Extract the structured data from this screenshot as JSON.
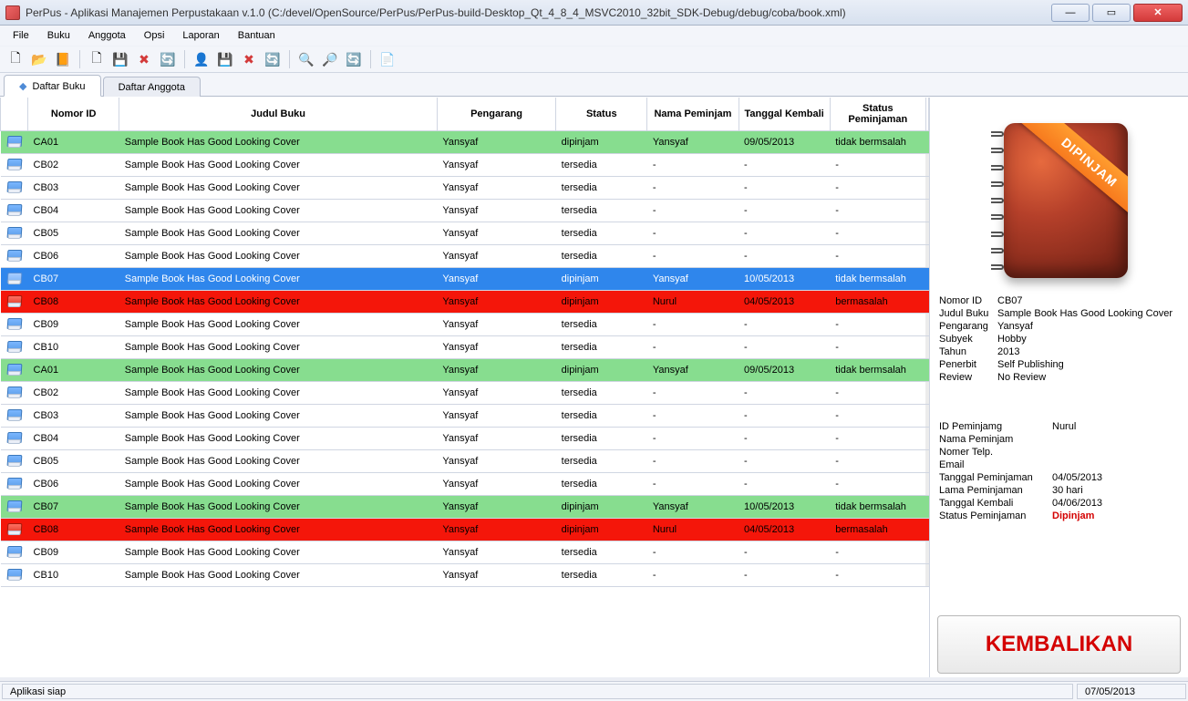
{
  "window": {
    "title": "PerPus - Aplikasi Manajemen Perpustakaan v.1.0 (C:/devel/OpenSource/PerPus/PerPus-build-Desktop_Qt_4_8_4_MSVC2010_32bit_SDK-Debug/debug/coba/book.xml)"
  },
  "menubar": [
    "File",
    "Buku",
    "Anggota",
    "Opsi",
    "Laporan",
    "Bantuan"
  ],
  "tabs": [
    {
      "label": "Daftar Buku",
      "active": true
    },
    {
      "label": "Daftar Anggota",
      "active": false
    }
  ],
  "table": {
    "headers": [
      "",
      "Nomor ID",
      "Judul Buku",
      "Pengarang",
      "Status",
      "Nama Peminjam",
      "Tanggal Kembali",
      "Status Peminjaman"
    ],
    "rows": [
      {
        "row_type": "green",
        "id": "CA01",
        "title": "Sample Book Has Good Looking Cover",
        "author": "Yansyaf",
        "status": "dipinjam",
        "borrower": "Yansyaf",
        "return": "09/05/2013",
        "loan_status": "tidak bermsalah"
      },
      {
        "row_type": "",
        "id": "CB02",
        "title": "Sample Book Has Good Looking Cover",
        "author": "Yansyaf",
        "status": "tersedia",
        "borrower": "-",
        "return": "-",
        "loan_status": "-"
      },
      {
        "row_type": "",
        "id": "CB03",
        "title": "Sample Book Has Good Looking Cover",
        "author": "Yansyaf",
        "status": "tersedia",
        "borrower": "-",
        "return": "-",
        "loan_status": "-"
      },
      {
        "row_type": "",
        "id": "CB04",
        "title": "Sample Book Has Good Looking Cover",
        "author": "Yansyaf",
        "status": "tersedia",
        "borrower": "-",
        "return": "-",
        "loan_status": "-"
      },
      {
        "row_type": "",
        "id": "CB05",
        "title": "Sample Book Has Good Looking Cover",
        "author": "Yansyaf",
        "status": "tersedia",
        "borrower": "-",
        "return": "-",
        "loan_status": "-"
      },
      {
        "row_type": "",
        "id": "CB06",
        "title": "Sample Book Has Good Looking Cover",
        "author": "Yansyaf",
        "status": "tersedia",
        "borrower": "-",
        "return": "-",
        "loan_status": "-"
      },
      {
        "row_type": "blue",
        "id": "CB07",
        "title": "Sample Book Has Good Looking Cover",
        "author": "Yansyaf",
        "status": "dipinjam",
        "borrower": "Yansyaf",
        "return": "10/05/2013",
        "loan_status": "tidak bermsalah"
      },
      {
        "row_type": "red",
        "id": "CB08",
        "title": "Sample Book Has Good Looking Cover",
        "author": "Yansyaf",
        "status": "dipinjam",
        "borrower": "Nurul",
        "return": "04/05/2013",
        "loan_status": "bermasalah"
      },
      {
        "row_type": "",
        "id": "CB09",
        "title": "Sample Book Has Good Looking Cover",
        "author": "Yansyaf",
        "status": "tersedia",
        "borrower": "-",
        "return": "-",
        "loan_status": "-"
      },
      {
        "row_type": "",
        "id": "CB10",
        "title": "Sample Book Has Good Looking Cover",
        "author": "Yansyaf",
        "status": "tersedia",
        "borrower": "-",
        "return": "-",
        "loan_status": "-"
      },
      {
        "row_type": "green",
        "id": "CA01",
        "title": "Sample Book Has Good Looking Cover",
        "author": "Yansyaf",
        "status": "dipinjam",
        "borrower": "Yansyaf",
        "return": "09/05/2013",
        "loan_status": "tidak bermsalah"
      },
      {
        "row_type": "",
        "id": "CB02",
        "title": "Sample Book Has Good Looking Cover",
        "author": "Yansyaf",
        "status": "tersedia",
        "borrower": "-",
        "return": "-",
        "loan_status": "-"
      },
      {
        "row_type": "",
        "id": "CB03",
        "title": "Sample Book Has Good Looking Cover",
        "author": "Yansyaf",
        "status": "tersedia",
        "borrower": "-",
        "return": "-",
        "loan_status": "-"
      },
      {
        "row_type": "",
        "id": "CB04",
        "title": "Sample Book Has Good Looking Cover",
        "author": "Yansyaf",
        "status": "tersedia",
        "borrower": "-",
        "return": "-",
        "loan_status": "-"
      },
      {
        "row_type": "",
        "id": "CB05",
        "title": "Sample Book Has Good Looking Cover",
        "author": "Yansyaf",
        "status": "tersedia",
        "borrower": "-",
        "return": "-",
        "loan_status": "-"
      },
      {
        "row_type": "",
        "id": "CB06",
        "title": "Sample Book Has Good Looking Cover",
        "author": "Yansyaf",
        "status": "tersedia",
        "borrower": "-",
        "return": "-",
        "loan_status": "-"
      },
      {
        "row_type": "green",
        "id": "CB07",
        "title": "Sample Book Has Good Looking Cover",
        "author": "Yansyaf",
        "status": "dipinjam",
        "borrower": "Yansyaf",
        "return": "10/05/2013",
        "loan_status": "tidak bermsalah"
      },
      {
        "row_type": "red",
        "id": "CB08",
        "title": "Sample Book Has Good Looking Cover",
        "author": "Yansyaf",
        "status": "dipinjam",
        "borrower": "Nurul",
        "return": "04/05/2013",
        "loan_status": "bermasalah"
      },
      {
        "row_type": "",
        "id": "CB09",
        "title": "Sample Book Has Good Looking Cover",
        "author": "Yansyaf",
        "status": "tersedia",
        "borrower": "-",
        "return": "-",
        "loan_status": "-"
      },
      {
        "row_type": "",
        "id": "CB10",
        "title": "Sample Book Has Good Looking Cover",
        "author": "Yansyaf",
        "status": "tersedia",
        "borrower": "-",
        "return": "-",
        "loan_status": "-"
      }
    ]
  },
  "side": {
    "ribbon": "DIPINJAM",
    "info_labels": {
      "id": "Nomor ID",
      "title": "Judul Buku",
      "author": "Pengarang",
      "subject": "Subyek",
      "year": "Tahun",
      "publisher": "Penerbit",
      "review": "Review"
    },
    "info_values": {
      "id": "CB07",
      "title": "Sample Book Has Good Looking Cover",
      "author": "Yansyaf",
      "subject": "Hobby",
      "year": "2013",
      "publisher": "Self Publishing",
      "review": "No Review"
    },
    "loan_labels": {
      "borrower_id": "ID Peminjamg",
      "borrower_name": "Nama Peminjam",
      "phone": "Nomer Telp.",
      "email": "Email",
      "loan_date": "Tanggal Peminjaman",
      "loan_length": "Lama Peminjaman",
      "return_date": "Tanggal Kembali",
      "loan_status": "Status Peminjaman"
    },
    "loan_values": {
      "borrower_id": "Nurul",
      "borrower_name": "",
      "phone": "",
      "email": "",
      "loan_date": "04/05/2013",
      "loan_length": "30 hari",
      "return_date": "04/06/2013",
      "loan_status": "Dipinjam"
    },
    "return_btn": "KEMBALIKAN"
  },
  "statusbar": {
    "message": "Aplikasi siap",
    "date": "07/05/2013"
  },
  "toolbar_icons": {
    "new_file": "🗋",
    "open_folder": "📂",
    "book_setting": "📙",
    "new_book": "🗋",
    "save_book": "💾",
    "delete_red": "✖",
    "refresh": "🔄",
    "user": "👤",
    "save2": "💾",
    "delete2": "✖",
    "refresh2": "🔄",
    "zoom_in": "🔍",
    "zoom_out": "🔎",
    "zoom_reset": "🔄",
    "export": "📄"
  }
}
